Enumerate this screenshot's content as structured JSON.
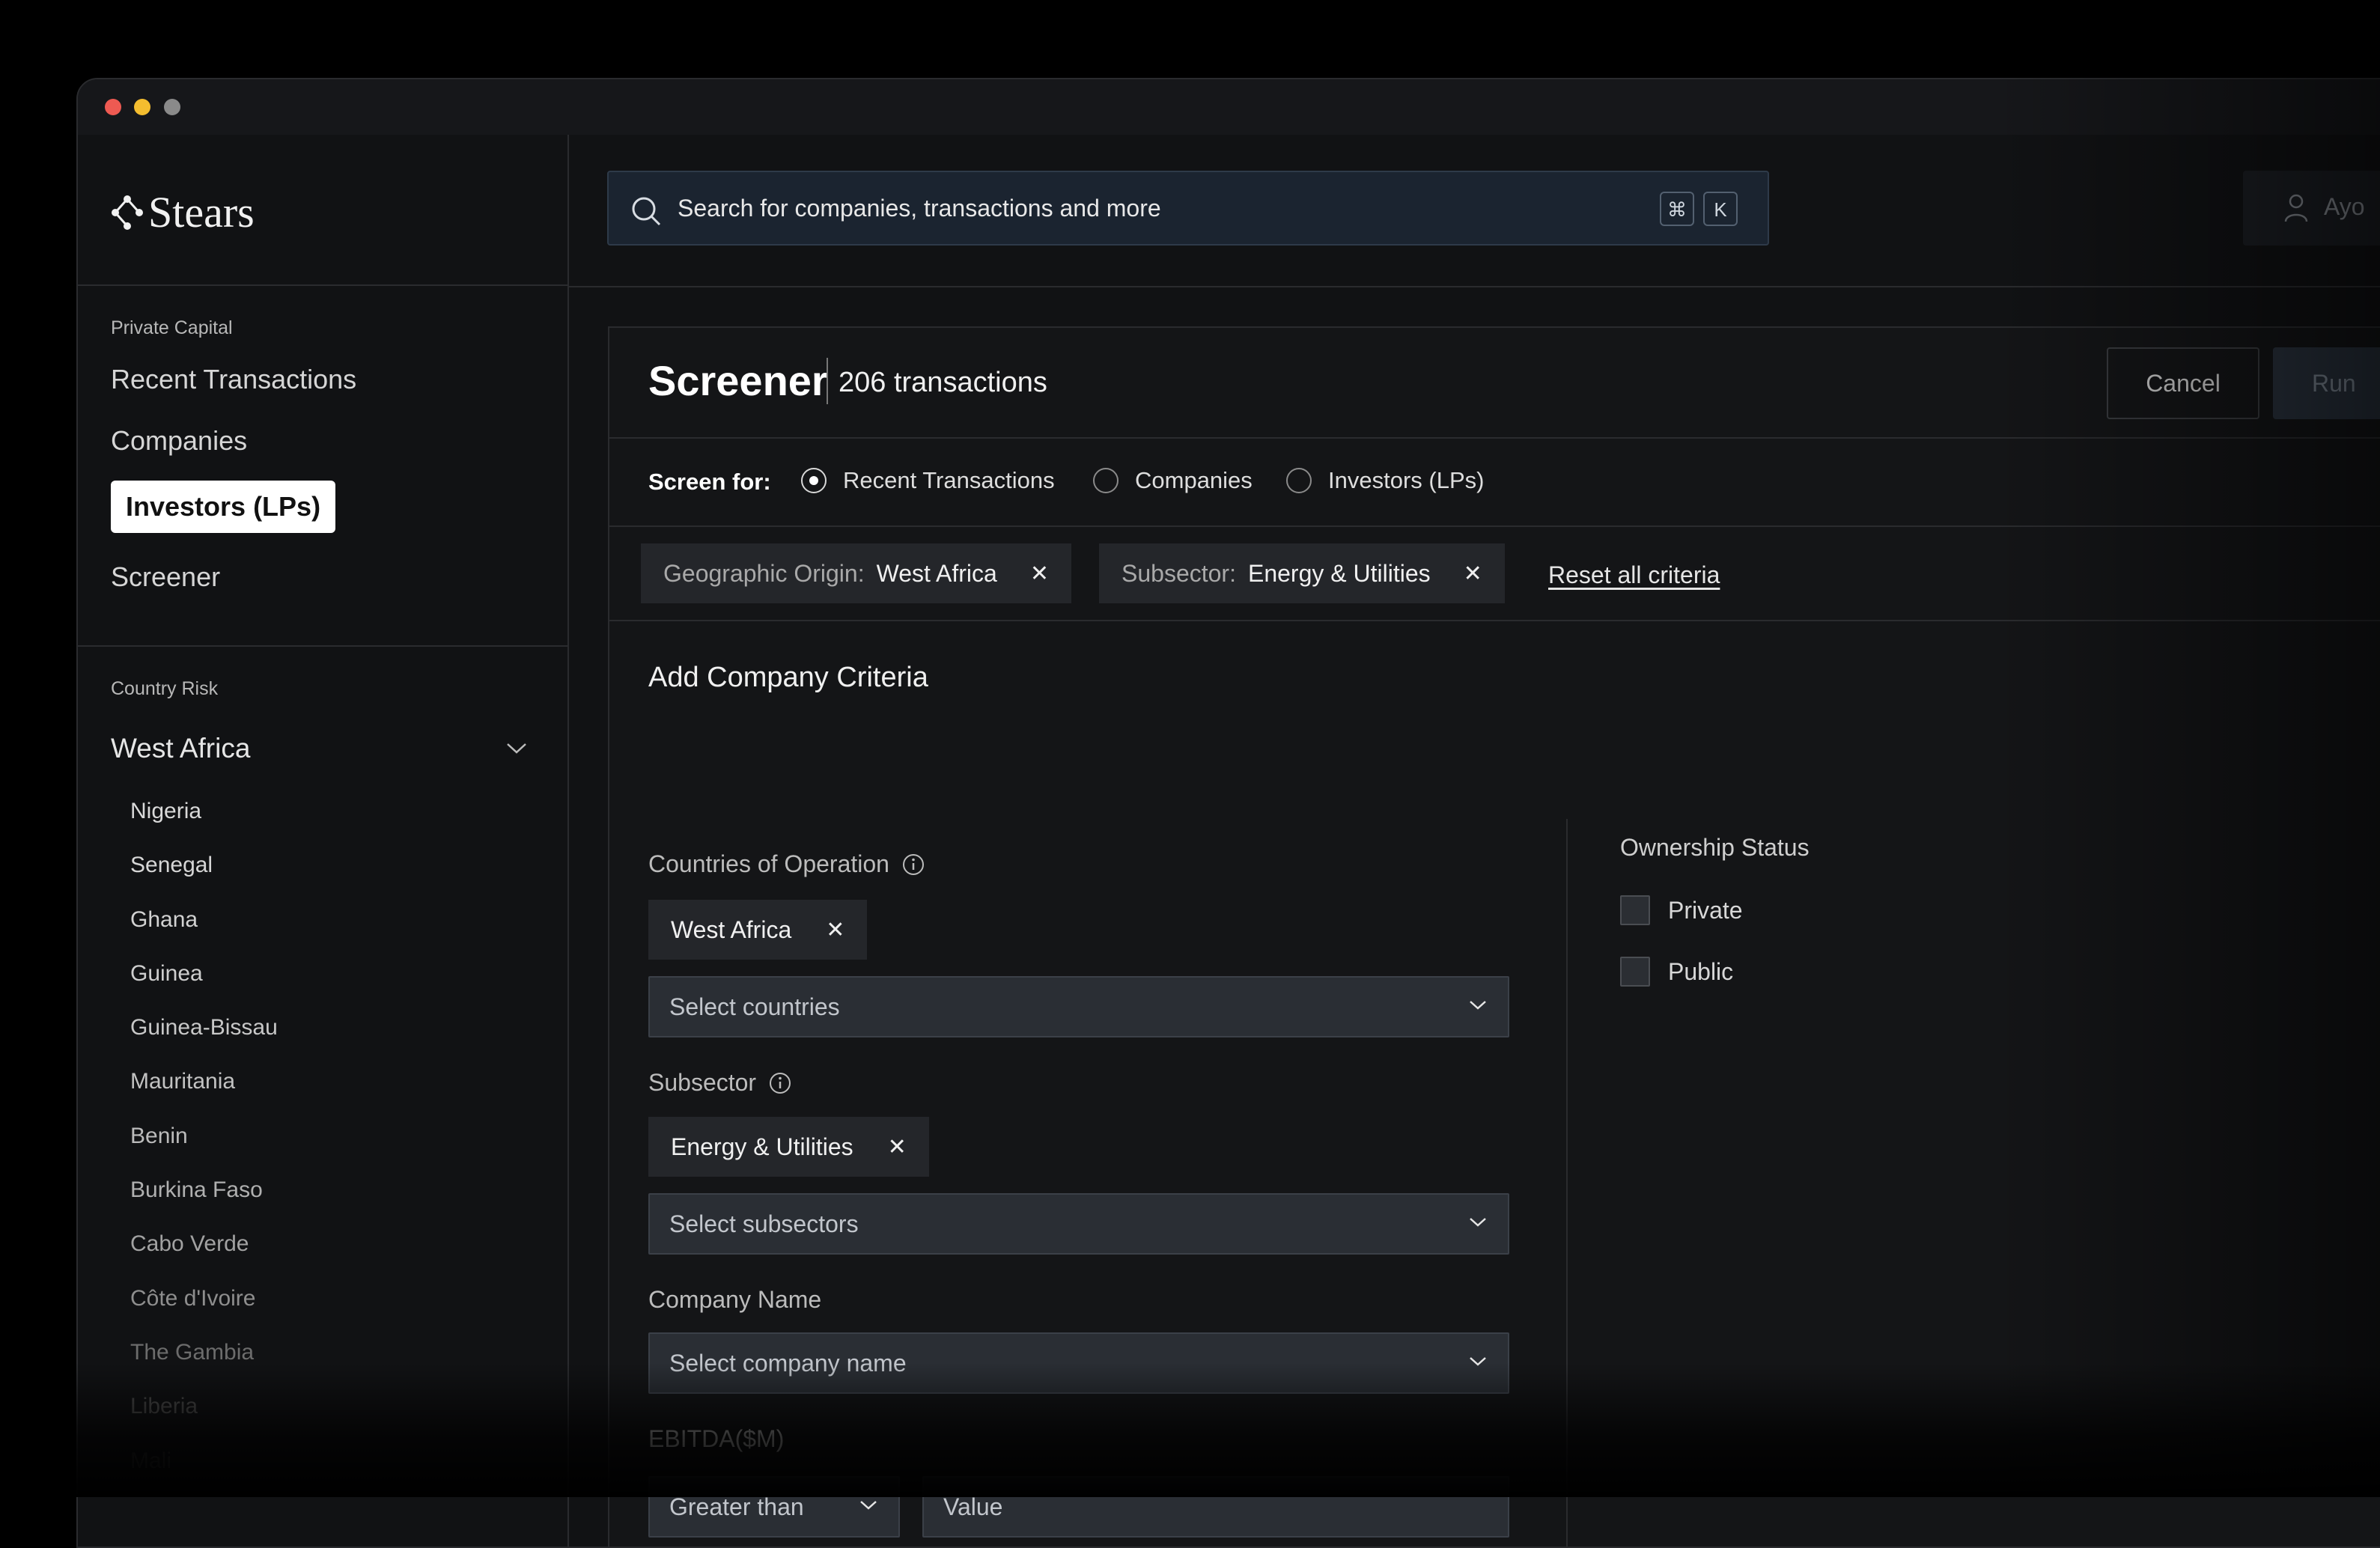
{
  "brand": {
    "name": "Stears"
  },
  "search": {
    "placeholder": "Search for companies, transactions and more",
    "shortcut_mod": "⌘",
    "shortcut_key": "K"
  },
  "user": {
    "label": "Ayo"
  },
  "sidebar": {
    "section_private": "Private Capital",
    "nav": [
      "Recent Transactions",
      "Companies",
      "Investors (LPs)",
      "Screener"
    ],
    "active_nav": "Investors (LPs)",
    "section_risk": "Country Risk",
    "region": "West Africa",
    "countries": [
      "Nigeria",
      "Senegal",
      "Ghana",
      "Guinea",
      "Guinea-Bissau",
      "Mauritania",
      "Benin",
      "Burkina Faso",
      "Cabo Verde",
      "Côte d'Ivoire",
      "The Gambia",
      "Liberia",
      "Mali"
    ]
  },
  "panel": {
    "title": "Screener",
    "count": "206 transactions",
    "cancel_label": "Cancel",
    "run_label": "Run",
    "screen_for_label": "Screen for:",
    "screen_options": [
      "Recent Transactions",
      "Companies",
      "Investors (LPs)"
    ],
    "selected_option": "Recent Transactions",
    "active_criteria": [
      {
        "key": "Geographic Origin:",
        "value": "West Africa"
      },
      {
        "key": "Subsector:",
        "value": "Energy & Utilities"
      }
    ],
    "reset_label": "Reset all criteria",
    "section_title": "Add Company Criteria",
    "countries_label": "Countries of Operation",
    "countries_tag": "West Africa",
    "countries_placeholder": "Select countries",
    "subsector_label": "Subsector",
    "subsector_tag": "Energy & Utilities",
    "subsector_placeholder": "Select subsectors",
    "company_label": "Company Name",
    "company_placeholder": "Select company name",
    "ebitda_label": "EBITDA($M)",
    "ebitda_operator": "Greater than",
    "ebitda_value_placeholder": "Value",
    "ownership_title": "Ownership Status",
    "ownership_options": [
      "Private",
      "Public"
    ]
  },
  "colors": {
    "background": "#000000",
    "window": "#111214",
    "accent_search": "#1b2430",
    "chip": "#24262a",
    "active_nav_bg": "#ffffff"
  }
}
